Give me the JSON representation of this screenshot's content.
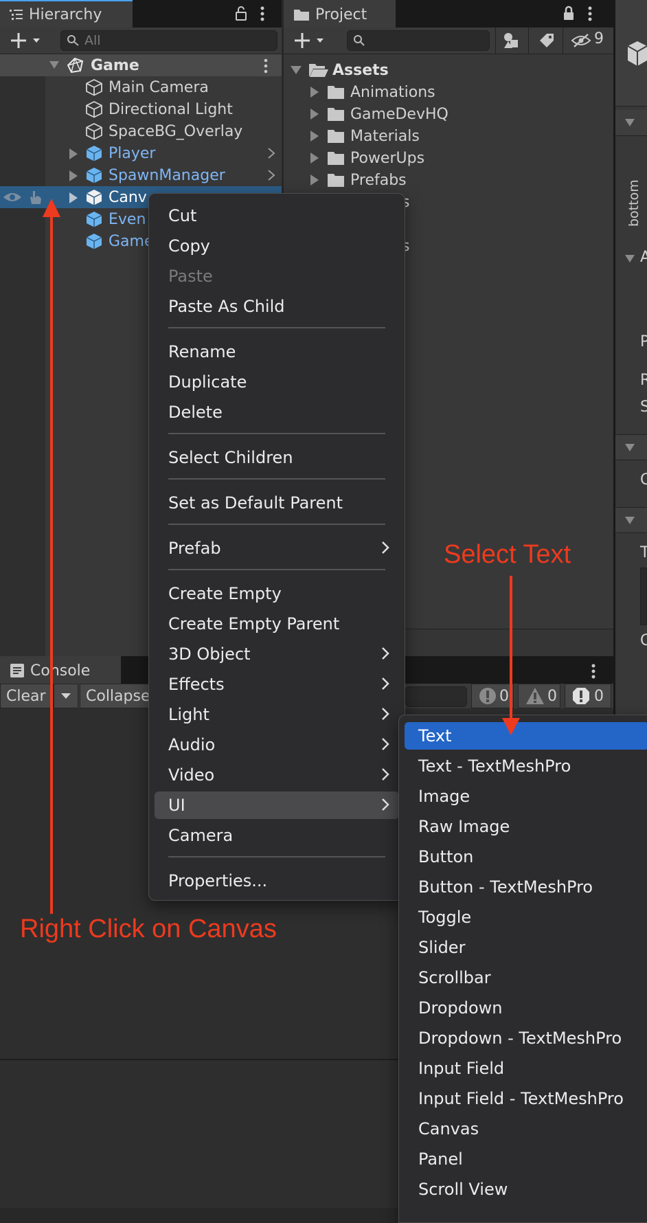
{
  "hierarchy": {
    "tab_label": "Hierarchy",
    "search_placeholder": "All",
    "scene": "Game",
    "items": [
      {
        "label": "Main Camera"
      },
      {
        "label": "Directional Light"
      },
      {
        "label": "SpaceBG_Overlay"
      },
      {
        "label": "Player"
      },
      {
        "label": "SpawnManager"
      },
      {
        "label": "Canv"
      },
      {
        "label": "Even"
      },
      {
        "label": "Game"
      }
    ]
  },
  "project": {
    "tab_label": "Project",
    "hidden_count": "9",
    "root": "Assets",
    "folders": [
      "Animations",
      "GameDevHQ",
      "Materials",
      "PowerUps",
      "Prefabs"
    ],
    "fragments": [
      "s",
      "s"
    ]
  },
  "inspector": {
    "side_label": "bottom",
    "letters": [
      "A",
      "P",
      "R",
      "S",
      "C",
      "T",
      "C"
    ]
  },
  "console": {
    "tab_label": "Console",
    "clear_label": "Clear",
    "collapse_label": "Collapse",
    "error_count": "0",
    "warning_count": "0",
    "info_count": "0"
  },
  "context_menu": {
    "items": [
      {
        "label": "Cut"
      },
      {
        "label": "Copy"
      },
      {
        "label": "Paste"
      },
      {
        "label": "Paste As Child"
      },
      {
        "label": "Rename"
      },
      {
        "label": "Duplicate"
      },
      {
        "label": "Delete"
      },
      {
        "label": "Select Children"
      },
      {
        "label": "Set as Default Parent"
      },
      {
        "label": "Prefab"
      },
      {
        "label": "Create Empty"
      },
      {
        "label": "Create Empty Parent"
      },
      {
        "label": "3D Object"
      },
      {
        "label": "Effects"
      },
      {
        "label": "Light"
      },
      {
        "label": "Audio"
      },
      {
        "label": "Video"
      },
      {
        "label": "UI"
      },
      {
        "label": "Camera"
      },
      {
        "label": "Properties..."
      }
    ]
  },
  "ui_submenu": {
    "items": [
      "Text",
      "Text - TextMeshPro",
      "Image",
      "Raw Image",
      "Button",
      "Button - TextMeshPro",
      "Toggle",
      "Slider",
      "Scrollbar",
      "Dropdown",
      "Dropdown - TextMeshPro",
      "Input Field",
      "Input Field - TextMeshPro",
      "Canvas",
      "Panel",
      "Scroll View"
    ]
  },
  "annotations": {
    "select_text": "Select Text",
    "right_click": "Right Click on Canvas",
    "color": "#ee3a1e"
  },
  "colors": {
    "selection_blue": "#2466c8",
    "row_selected": "#2c5d87",
    "prefab_blue": "#7fb6f5"
  }
}
